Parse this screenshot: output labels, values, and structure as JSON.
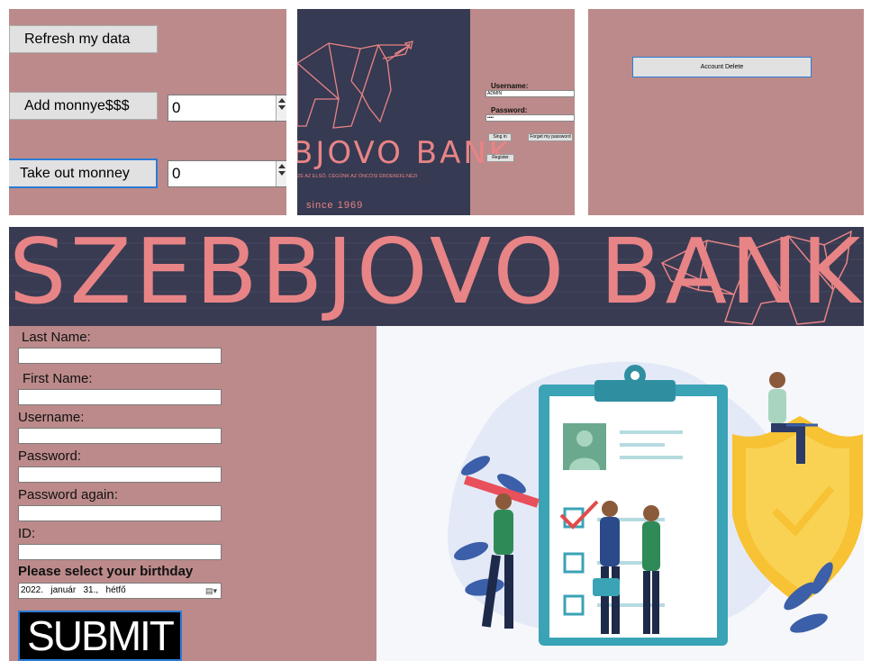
{
  "panel1": {
    "refresh_label": "Refresh my data",
    "add_label": "Add monnye$$$",
    "add_value": "0",
    "takeout_label": "Take out monney",
    "takeout_value": "0"
  },
  "panel2": {
    "brand": "BJOVO BANK",
    "slogan": "ZE AZ ELSŐ.  CÉGÜNK AZ ŐNCÖSI ÉRDEKEIG NÉZI",
    "since": "since 1969",
    "username_label": "Username:",
    "username_value": "ADMIN",
    "password_label": "Password:",
    "password_value": "••••",
    "signin_label": "Sing in",
    "forgot_label": "Forget my password",
    "register_label": "Register"
  },
  "panel3": {
    "delete_label": "Account Delete"
  },
  "register": {
    "banner_title": "SZEBBJOVO BANK",
    "fields": {
      "lastname": "Last Name:",
      "firstname": "First Name:",
      "username": "Username:",
      "password": "Password:",
      "password_again": "Password again:",
      "id": "ID:"
    },
    "birthday_label": "Please select your birthday",
    "birthday_value": "2022.   január   31.,   hétfő",
    "submit_label": "SUBMIT"
  },
  "colors": {
    "panel_bg": "#bc8a8a",
    "dark_bg": "#363a52",
    "brand_pink": "#e88486",
    "shield_yellow": "#f7c233",
    "teal": "#3aa3b5"
  },
  "icons": [
    "spin-up-icon",
    "spin-down-icon",
    "bull-logo-icon",
    "calendar-icon",
    "shield-check-icon",
    "clipboard-icon"
  ]
}
